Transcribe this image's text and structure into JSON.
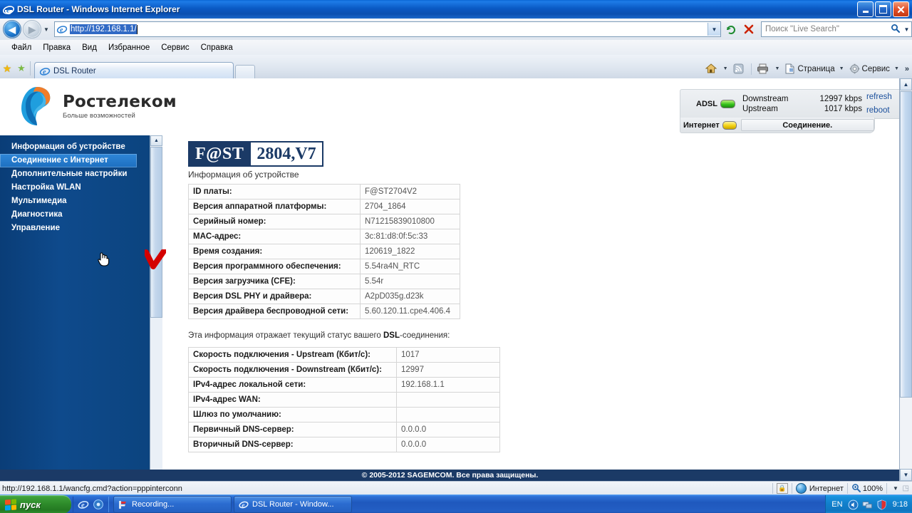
{
  "window": {
    "title": "DSL Router - Windows Internet Explorer",
    "icon": "ie-icon",
    "minimize_label": "–",
    "restore_label": "❐",
    "close_label": "✕"
  },
  "navigation": {
    "back_label": "◀",
    "forward_label": "▶",
    "history_caret": "▼",
    "address_value": "http://192.168.1.1/",
    "address_dropdown": "▼",
    "refresh_label": "↻",
    "stop_label": "✕",
    "search_placeholder": "Поиск \"Live Search\"",
    "search_go": "🔍",
    "search_dropdown": "▼"
  },
  "menu": {
    "items": [
      {
        "label": "Файл"
      },
      {
        "label": "Правка"
      },
      {
        "label": "Вид"
      },
      {
        "label": "Избранное"
      },
      {
        "label": "Сервис"
      },
      {
        "label": "Справка"
      }
    ]
  },
  "tabs": {
    "favorites_star": "★",
    "add_favorite": "★",
    "items": [
      {
        "label": "DSL Router",
        "icon": "ie-icon",
        "active": true
      }
    ],
    "new_tab_label": ""
  },
  "command_bar": {
    "home_icon": "home-icon",
    "home_caret": "▼",
    "feeds_icon": "rss-icon",
    "print_icon": "printer-icon",
    "print_caret": "▼",
    "page_label": "Страница",
    "page_caret": "▼",
    "tools_label": "Сервис",
    "tools_caret": "▼",
    "overflow": "»"
  },
  "router": {
    "brand": {
      "name": "Ростелеком",
      "tagline": "Больше возможностей"
    },
    "status_panel": {
      "adsl_label": "ADSL",
      "adsl_led_color": "#36c21c",
      "downstream_label": "Downstream",
      "downstream_value": "12997 kbps",
      "upstream_label": "Upstream",
      "upstream_value": "1017 kbps",
      "refresh_label": "refresh",
      "reboot_label": "reboot",
      "internet_label": "Интернет",
      "internet_led_color": "#f2d011",
      "connection_status": "Соединение."
    },
    "sidebar": {
      "items": [
        {
          "label": "Информация об устройстве",
          "active": false
        },
        {
          "label": "Соединение с Интернет",
          "active": true
        },
        {
          "label": "Дополнительные настройки",
          "active": false
        },
        {
          "label": "Настройка WLAN",
          "active": false
        },
        {
          "label": "Мультимедиа",
          "active": false
        },
        {
          "label": "Диагностика",
          "active": false
        },
        {
          "label": "Управление",
          "active": false
        }
      ]
    },
    "banner": {
      "left": "F@ST",
      "right": "2804,V7"
    },
    "section_title": "Информация об устройстве",
    "device_info": [
      {
        "key": "ID платы:",
        "value": "F@ST2704V2"
      },
      {
        "key": "Версия аппаратной платформы:",
        "value": "2704_1864"
      },
      {
        "key": "Серийный номер:",
        "value": "N71215839010800"
      },
      {
        "key": "MAC-адрес:",
        "value": "3c:81:d8:0f:5c:33"
      },
      {
        "key": "Время создания:",
        "value": "120619_1822"
      },
      {
        "key": "Версия программного обеспечения:",
        "value": "5.54ra4N_RTC"
      },
      {
        "key": "Версия загрузчика (CFE):",
        "value": "5.54r"
      },
      {
        "key": "Версия DSL PHY и драйвера:",
        "value": "A2pD035g.d23k"
      },
      {
        "key": "Версия драйвера беспроводной сети:",
        "value": "5.60.120.11.cpe4.406.4"
      }
    ],
    "dsl_note_prefix": "Эта информация отражает текущий статус вашего ",
    "dsl_note_bold": "DSL",
    "dsl_note_suffix": "-соединения:",
    "dsl_status": [
      {
        "key": "Скорость подключения - Upstream (Кбит/с):",
        "value": "1017"
      },
      {
        "key": "Скорость подключения - Downstream (Кбит/с):",
        "value": "12997"
      },
      {
        "key": "IPv4-адрес локальной сети:",
        "value": "192.168.1.1"
      },
      {
        "key": "IPv4-адрес WAN:",
        "value": ""
      },
      {
        "key": "Шлюз по умолчанию:",
        "value": ""
      },
      {
        "key": "Первичный DNS-сервер:",
        "value": "0.0.0.0"
      },
      {
        "key": "Вторичный DNS-сервер:",
        "value": "0.0.0.0"
      }
    ],
    "footer": "© 2005-2012 SAGEMCOM. Все права защищены."
  },
  "status_bar": {
    "link_url": "http://192.168.1.1/wancfg.cmd?action=pppinterconn",
    "zone_label": "Интернет",
    "zoom_level": "100%",
    "zoom_caret": "▼"
  },
  "taskbar": {
    "start_label": "пуск",
    "quick_launch": [
      {
        "icon": "ie-icon"
      },
      {
        "icon": "media-icon"
      }
    ],
    "buttons": [
      {
        "label": "Recording...",
        "icon": "recorder-icon"
      },
      {
        "label": "DSL Router - Window...",
        "icon": "ie-icon"
      }
    ],
    "tray": {
      "language": "EN",
      "icons": [
        "volume-icon",
        "network-icon",
        "shield-icon"
      ],
      "clock": "9:18"
    }
  }
}
